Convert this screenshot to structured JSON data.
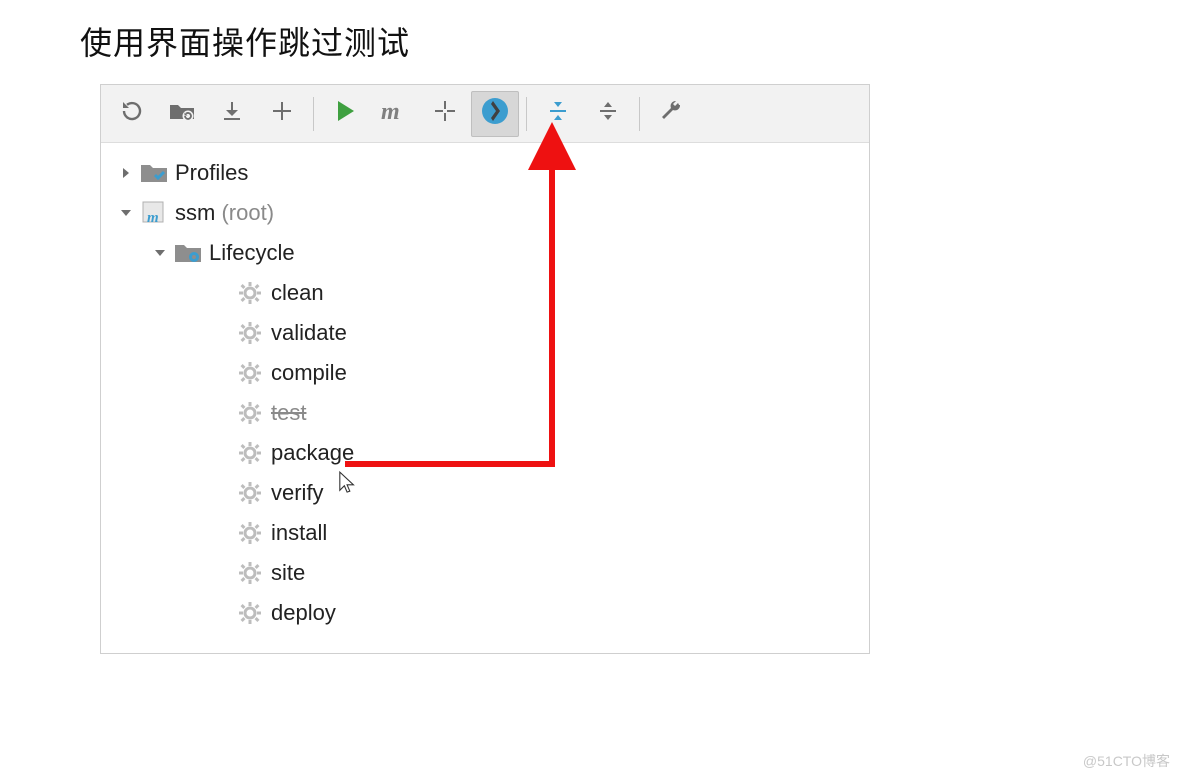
{
  "heading": "使用界面操作跳过测试",
  "toolbar": {
    "buttons": [
      {
        "name": "reload-icon"
      },
      {
        "name": "folder-refresh-icon"
      },
      {
        "name": "download-icon"
      },
      {
        "name": "plus-icon"
      },
      {
        "name": "separator"
      },
      {
        "name": "run-icon"
      },
      {
        "name": "maven-m-icon"
      },
      {
        "name": "execute-goal-icon"
      },
      {
        "name": "skip-tests-icon",
        "selected": true
      },
      {
        "name": "separator"
      },
      {
        "name": "collapse-icon"
      },
      {
        "name": "expand-icon"
      },
      {
        "name": "separator"
      },
      {
        "name": "wrench-icon"
      }
    ]
  },
  "tree": {
    "profiles": {
      "label": "Profiles",
      "expanded": false
    },
    "root": {
      "name": "ssm",
      "suffix": "(root)",
      "expanded": true,
      "lifecycle": {
        "label": "Lifecycle",
        "expanded": true,
        "phases": [
          {
            "name": "clean",
            "skipped": false
          },
          {
            "name": "validate",
            "skipped": false
          },
          {
            "name": "compile",
            "skipped": false
          },
          {
            "name": "test",
            "skipped": true
          },
          {
            "name": "package",
            "skipped": false
          },
          {
            "name": "verify",
            "skipped": false
          },
          {
            "name": "install",
            "skipped": false
          },
          {
            "name": "site",
            "skipped": false
          },
          {
            "name": "deploy",
            "skipped": false
          }
        ]
      }
    }
  },
  "watermark": "@51CTO博客"
}
